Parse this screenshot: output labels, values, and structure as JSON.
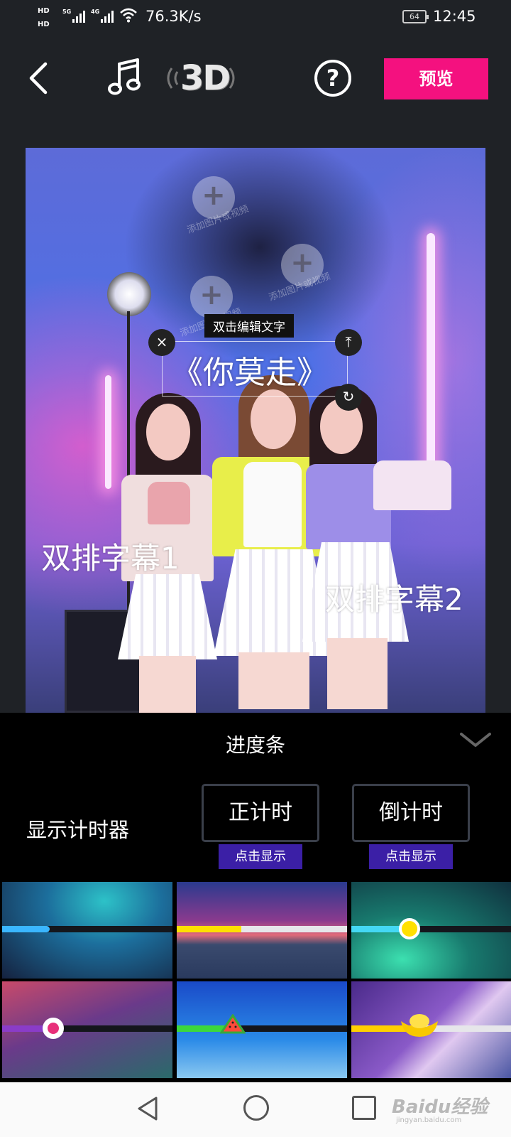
{
  "status_bar": {
    "hd1": "HD",
    "hd2": "HD",
    "net1": "5G",
    "net2": "4G",
    "speed": "76.3K/s",
    "battery": "64",
    "time": "12:45",
    "icons": [
      "signal-icon",
      "wifi-icon",
      "battery-icon"
    ]
  },
  "toolbar": {
    "back_icon": "chevron-left-icon",
    "music_icon": "music-note-icon",
    "three_d_label": "3D",
    "help_label": "?",
    "preview_label": "预览",
    "accent_color": "#f4117f"
  },
  "stage": {
    "edit_tip": "双击编辑文字",
    "title_text": "《你莫走》",
    "close_icon": "×",
    "pin_icon": "⤒",
    "rotate_icon": "↻",
    "subtitle_1": "双排字幕1",
    "subtitle_2": "双排字幕2",
    "watermark_text": "添加图片或视频"
  },
  "panel": {
    "title": "进度条",
    "collapse_icon": "chevron-down-icon",
    "timer_label": "显示计时器",
    "count_up_label": "正计时",
    "count_down_label": "倒计时",
    "tap_to_show": "点击显示",
    "tag_color": "#3b1fa6"
  },
  "progress_styles": [
    {
      "fill_color": "#3ab6ff",
      "progress": 0.28,
      "knob": "none"
    },
    {
      "fill_color": "#ffe000",
      "progress": 0.38,
      "knob": "none"
    },
    {
      "fill_color": "#44d8f4",
      "progress": 0.34,
      "knob": "yellow-dot"
    },
    {
      "fill_color": "#8a3cc8",
      "progress": 0.3,
      "knob": "pink-dot"
    },
    {
      "fill_color": "#3cd83c",
      "progress": 0.33,
      "knob": "watermelon"
    },
    {
      "fill_color": "#ffd000",
      "progress": 0.4,
      "knob": "gold-ingot"
    }
  ],
  "nav_bar": {
    "back_icon": "triangle-back-icon",
    "home_icon": "circle-home-icon",
    "recent_icon": "square-recent-icon",
    "watermark": "Baidu经验",
    "watermark_sub": "jingyan.baidu.com"
  }
}
